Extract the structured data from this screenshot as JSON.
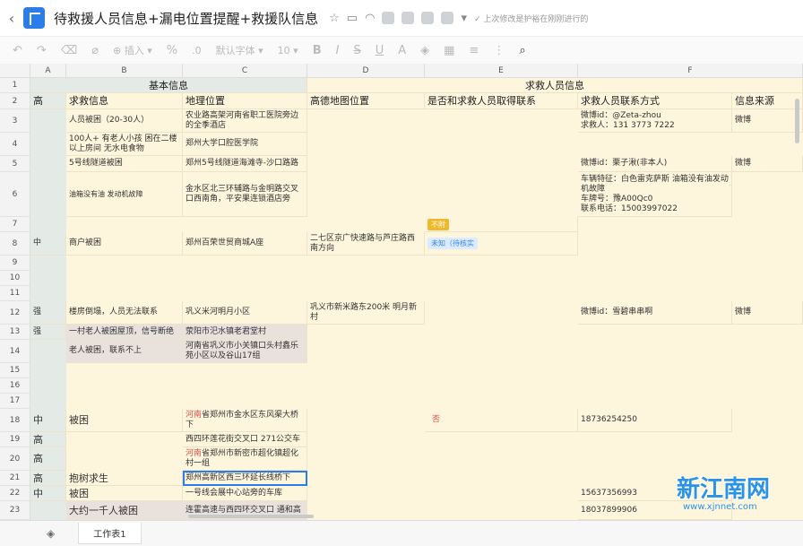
{
  "doc": {
    "title": "待救援人员信息+漏电位置提醒+救援队信息",
    "save_note": "上次修改是护裕在刚刚进行的"
  },
  "toolbar": {
    "insert": "插入",
    "font": "默认字体",
    "font_size": "10"
  },
  "columns": [
    "A",
    "B",
    "C",
    "D",
    "E",
    "F"
  ],
  "rows": [
    "1",
    "2",
    "3",
    "4",
    "5",
    "6",
    "7",
    "8",
    "9",
    "10",
    "11",
    "12",
    "13",
    "14",
    "15",
    "16",
    "17",
    "18",
    "19",
    "20",
    "21",
    "22",
    "23"
  ],
  "table": {
    "group_basic": "基本信息",
    "group_rescuer": "求救人员信息",
    "headers": {
      "level": "高",
      "request": "求救信息",
      "location": "地理位置",
      "amap": "高德地图位置",
      "contacted": "是否和求救人员取得联系",
      "contact": "求救人员联系方式",
      "source": "信息来源"
    },
    "r3": {
      "b": "人员被困（20-30人）",
      "c": "农业路高架河南省职工医院旁边的全季酒店",
      "f": "微博id：@Zeta-zhou\n求救人：131 3773 7222",
      "g": "微博"
    },
    "r4": {
      "b": "100人+ 有老人小孩 困在二楼以上房间 无水电食物",
      "c": "郑州大学口腔医学院"
    },
    "r5": {
      "b": "5号线隧道被困",
      "c": "郑州5号线隧道海滩寺-沙口路路",
      "f": "微博id：栗子湫(非本人)",
      "g": "微博"
    },
    "r6": {
      "b": "油箱没有油 发动机故障",
      "c": "金水区北三环辅路与金明路交叉口西南角，平安果连锁酒店旁",
      "f": "车辆特征：白色雷克萨斯  油箱没有油发动机故障\n车牌号：豫A00Qc0\n联系电话：15003997022"
    },
    "r7": {
      "e": "不附"
    },
    "r8": {
      "a": "中",
      "b": "商户被困",
      "c": "郑州百荣世贸商城A座",
      "d": "二七区京广快速路与芦庄路西南方向",
      "e": "未知（待核实"
    },
    "r12": {
      "a": "强",
      "b": "楼房倒塌，人员无法联系",
      "c": "巩义米河明月小区",
      "d": "巩义市新米路东200米 明月新村",
      "f": "微博id：雪碧串串啊",
      "g": "微博"
    },
    "r13": {
      "a": "强",
      "b": "一村老人被困屋顶，信号断绝",
      "c": "荥阳市汜水镇老君堂村"
    },
    "r14": {
      "b": "老人被困，联系不上",
      "c": "河南省巩义市小关镇口头村鑫乐苑小区以及谷山17组"
    },
    "r18": {
      "a": "中",
      "b": "被困",
      "c_red": "河南",
      "c": "省郑州市金水区东风渠大桥下",
      "e": "否",
      "f": "18736254250"
    },
    "r19": {
      "a": "高",
      "c": "西四环莲花街交叉口 271公交车"
    },
    "r20": {
      "a": "高",
      "c_red": "河南",
      "c": "省郑州市新密市超化镇超化村一组"
    },
    "r21": {
      "a": "高",
      "b": "抱树求生",
      "c": "郑州高新区西三环延长线桥下"
    },
    "r22": {
      "a": "中",
      "b": "被困",
      "c": "一号线会展中心站旁的车库",
      "f": "15637356993"
    },
    "r23": {
      "b": "大约一千人被困",
      "c": "连霍高速与西四环交叉口 通和高",
      "f": "18037899906"
    }
  },
  "sheet": {
    "tab": "工作表1"
  },
  "watermark": {
    "text": "新江南网",
    "url": "www.xjnnet.com"
  }
}
